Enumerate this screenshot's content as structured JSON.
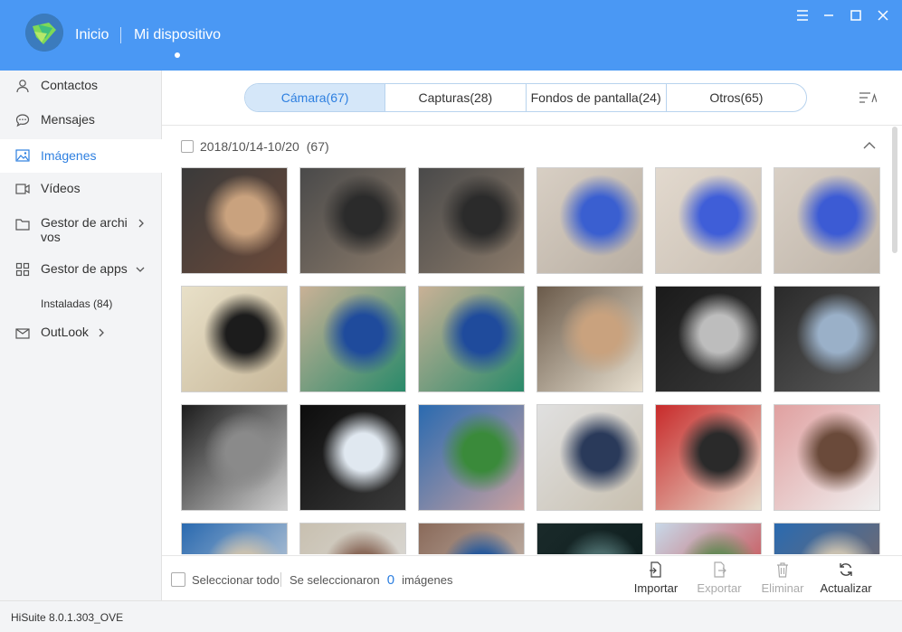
{
  "header": {
    "nav_home": "Inicio",
    "nav_device": "Mi dispositivo",
    "accent": "#4a98f4"
  },
  "sidebar": {
    "items": [
      {
        "label": "Contactos",
        "icon": "person-icon"
      },
      {
        "label": "Mensajes",
        "icon": "chat-bubble-icon"
      },
      {
        "label": "Imágenes",
        "icon": "image-icon",
        "active": true
      },
      {
        "label": "Vídeos",
        "icon": "video-icon"
      },
      {
        "label": "Gestor de archi\nvos",
        "icon": "folder-icon"
      },
      {
        "label": "Gestor de apps",
        "icon": "apps-grid-icon"
      },
      {
        "label": "Instaladas (84)",
        "icon": ""
      },
      {
        "label": "OutLook",
        "icon": "mail-icon"
      }
    ]
  },
  "tabs": [
    {
      "label": "Cámara(67)",
      "active": true
    },
    {
      "label": "Capturas(28)"
    },
    {
      "label": "Fondos de pantalla(24)"
    },
    {
      "label": "Otros(65)"
    }
  ],
  "group": {
    "date_range": "2018/10/14-10/20",
    "count": "(67)"
  },
  "footer": {
    "select_all": "Seleccionar todo",
    "selected_prefix": "Se seleccionaron",
    "selected_count": "0",
    "selected_suffix": "imágenes",
    "actions": [
      {
        "label": "Importar",
        "icon": "import-icon",
        "enabled": true
      },
      {
        "label": "Exportar",
        "icon": "export-icon",
        "enabled": false
      },
      {
        "label": "Eliminar",
        "icon": "trash-icon",
        "enabled": false
      },
      {
        "label": "Actualizar",
        "icon": "refresh-icon",
        "enabled": true
      }
    ]
  },
  "status": {
    "version": "HiSuite 8.0.1.303_OVE"
  },
  "photos": [
    {
      "alt": "selfie-group",
      "colors": [
        "#3a3a3a",
        "#c9a27e",
        "#6b4a3a"
      ]
    },
    {
      "alt": "phone-in-hand-wall",
      "colors": [
        "#4a4a4a",
        "#2b2b2b",
        "#8a7a6a"
      ]
    },
    {
      "alt": "phone-in-hand-wall",
      "colors": [
        "#4a4a4a",
        "#2b2b2b",
        "#8a7a6a"
      ]
    },
    {
      "alt": "phone-on-table",
      "colors": [
        "#d8cfc4",
        "#3a5fd0",
        "#b8aea2"
      ]
    },
    {
      "alt": "phone-on-table",
      "colors": [
        "#e2d9ce",
        "#3f5ed8",
        "#c9bfb3"
      ]
    },
    {
      "alt": "phone-on-table",
      "colors": [
        "#d9d0c6",
        "#3c5bd4",
        "#bdb3a7"
      ]
    },
    {
      "alt": "curtain-closeup",
      "colors": [
        "#e8e0c8",
        "#1c1c1c",
        "#c8b89a"
      ]
    },
    {
      "alt": "phone-homescreen",
      "colors": [
        "#c9b196",
        "#1f4b9c",
        "#2a8a6a"
      ]
    },
    {
      "alt": "phone-homescreen",
      "colors": [
        "#c9b196",
        "#1f4b9c",
        "#2a8a6a"
      ]
    },
    {
      "alt": "selfie-headphones",
      "colors": [
        "#6a5a4a",
        "#c9a27e",
        "#e8e0d0"
      ]
    },
    {
      "alt": "bmw-badge",
      "colors": [
        "#1a1a1a",
        "#bdbdbd",
        "#3a3a3a"
      ]
    },
    {
      "alt": "driving-car",
      "colors": [
        "#2a2a2a",
        "#9ab0c8",
        "#5a5a5a"
      ]
    },
    {
      "alt": "car-dashboard",
      "colors": [
        "#1c1c1c",
        "#8a8a8a",
        "#d0d0d0"
      ]
    },
    {
      "alt": "light-projection",
      "colors": [
        "#0d0d0d",
        "#e0e8f0",
        "#3a3a3a"
      ]
    },
    {
      "alt": "fifa-event",
      "colors": [
        "#2a6ab0",
        "#3a8a3a",
        "#c8a0a0"
      ]
    },
    {
      "alt": "man-with-sign",
      "colors": [
        "#e0e0e0",
        "#2a3a5a",
        "#c8c0b0"
      ]
    },
    {
      "alt": "two-men-store",
      "colors": [
        "#c82a2a",
        "#2a2a2a",
        "#e8e0d0"
      ]
    },
    {
      "alt": "toy-figure",
      "colors": [
        "#e0a0a0",
        "#6a4a3a",
        "#f0f0f0"
      ]
    },
    {
      "alt": "event-screen",
      "colors": [
        "#2a6ab0",
        "#c8c0b0",
        "#e0e0e0"
      ]
    },
    {
      "alt": "crowd-hall",
      "colors": [
        "#c8c0b0",
        "#8a6a5a",
        "#e0e0e0"
      ]
    },
    {
      "alt": "exhibition",
      "colors": [
        "#8a6a5a",
        "#2a5a9a",
        "#d0c8c0"
      ]
    },
    {
      "alt": "dark-abstract",
      "colors": [
        "#1a2a2a",
        "#4a6a6a",
        "#0a1a1a"
      ]
    },
    {
      "alt": "street-trees",
      "colors": [
        "#c8d8e8",
        "#6a8a5a",
        "#c82a2a"
      ]
    },
    {
      "alt": "event-crowd",
      "colors": [
        "#2a6ab0",
        "#c8c0b0",
        "#8a6a5a"
      ]
    }
  ]
}
